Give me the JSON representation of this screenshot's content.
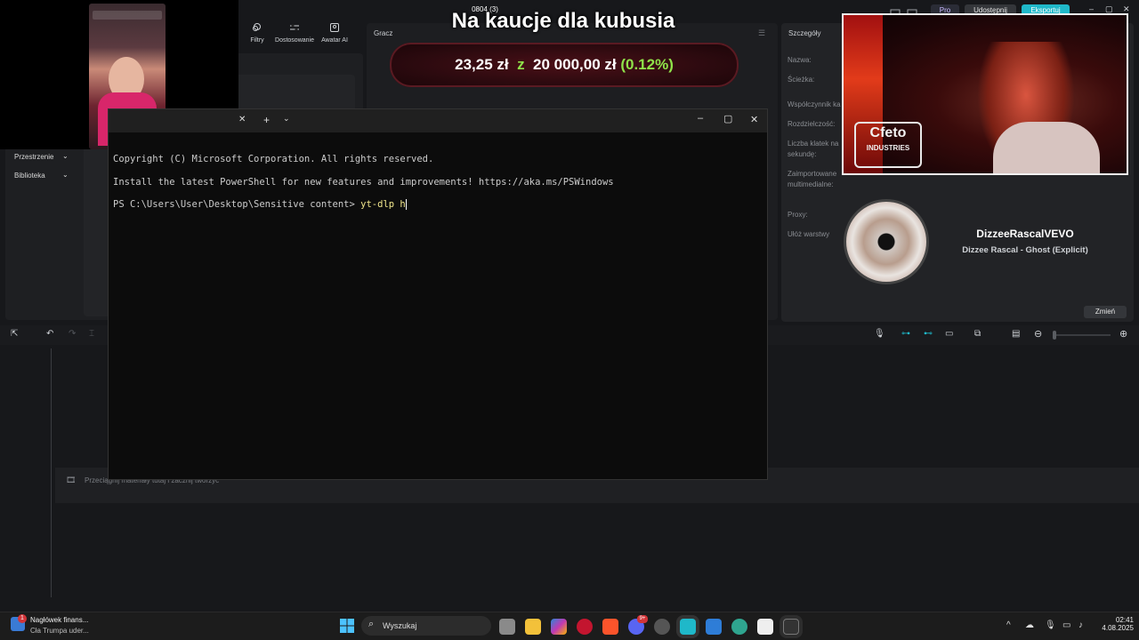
{
  "editor": {
    "toolbar": {
      "filters": "Filtry",
      "adjust": "Dostosowanie",
      "avatar": "Awatar AI"
    },
    "player_label": "Gracz",
    "left_menu": [
      "Przestrzenie",
      "Biblioteka"
    ],
    "details": {
      "title": "Szczegóły",
      "labels": [
        "Nazwa:",
        "Ścieżka:",
        "Współczynnik ka",
        "Rozdzielczość:",
        "Liczba klatek na sekundę:",
        "Zaimportowane multimedialne:",
        "Proxy:",
        "Ułóż warstwy"
      ],
      "change_button": "Zmień"
    },
    "topbar": {
      "pro": "Pro",
      "share": "Udostępnij",
      "export": "Eksportuj"
    },
    "timeline_hint": "Przeciągnij materiały tutaj i zacznij tworzyć"
  },
  "overlay": {
    "counter": "0804 (3)",
    "title": "Na kaucje dla kubusia",
    "donation_current": "23,25 zł",
    "donation_sep": "z",
    "donation_goal": "20 000,00 zł",
    "donation_percent": "(0.12%)",
    "webcam_logo_line1": "Cfeto",
    "webcam_logo_line2": "INDUSTRIES",
    "track_artist": "DizzeeRascalVEVO",
    "track_title": "Dizzee Rascal - Ghost (Explicit)"
  },
  "terminal": {
    "line1": "Copyright (C) Microsoft Corporation. All rights reserved.",
    "line2": "Install the latest PowerShell for new features and improvements! https://aka.ms/PSWindows",
    "prompt": "PS C:\\Users\\User\\Desktop\\Sensitive content> ",
    "command": "yt-dlp h"
  },
  "taskbar": {
    "news_badge": "1",
    "news_title": "Nagłówek finans...",
    "news_sub": "Cła Trumpa uder...",
    "search_placeholder": "Wyszukaj",
    "time": "02:41",
    "date": "4.08.2025",
    "discord_badge": "9+"
  },
  "colors": {
    "accent_teal": "#1fb8c9",
    "donation_green": "#8fe34a",
    "terminal_bg": "#0c0c0c"
  }
}
